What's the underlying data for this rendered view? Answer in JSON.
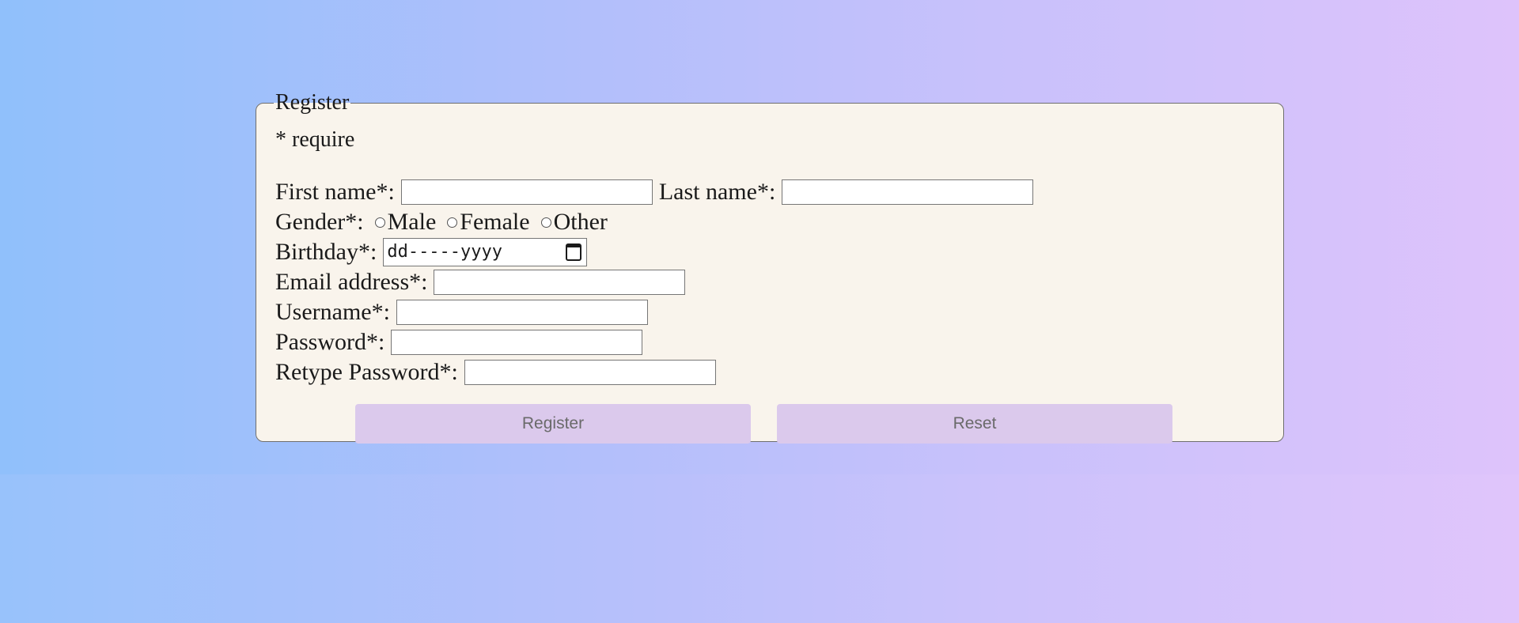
{
  "form": {
    "legend": "Register",
    "require_note": "* require",
    "first_name_label": "First name*:",
    "last_name_label": "Last name*:",
    "gender_label": "Gender*:",
    "gender_options": [
      "Male",
      "Female",
      "Other"
    ],
    "birthday_label": "Birthday*:",
    "birthday_placeholder": "dd-----yyyy",
    "email_label": "Email address*:",
    "username_label": "Username*:",
    "password_label": "Password*:",
    "retype_password_label": "Retype Password*:",
    "register_button": "Register",
    "reset_button": "Reset"
  },
  "colors": {
    "panel_background": "#f9f4ec",
    "button_background": "#dbc9ec",
    "gradient_left": "#90c0fb",
    "gradient_right": "#dec3fb"
  },
  "icons": {
    "birthday_picker": "calendar-icon"
  }
}
